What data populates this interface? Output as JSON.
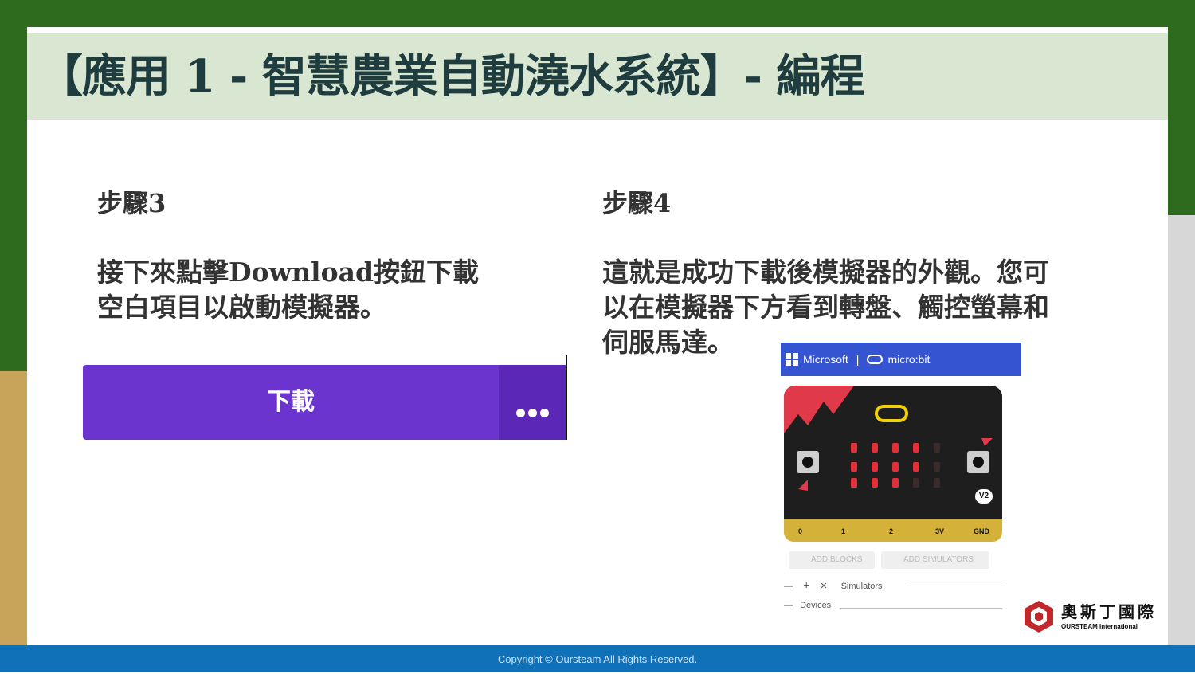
{
  "slide": {
    "title": "【應用 1 - 智慧農業自動澆水系統】- 編程",
    "step3": {
      "label": "步驟3",
      "line1": "接下來點擊Download按鈕下載",
      "line2": "空白項目以啟動模擬器。"
    },
    "step4": {
      "label": "步驟4",
      "line1": "這就是成功下載後模擬器的外觀。您可",
      "line2": "以在模擬器下方看到轉盤、觸控螢幕和",
      "line3": "伺服馬達。"
    }
  },
  "download_button": {
    "label": "下載",
    "more_icon": "ellipsis-icon",
    "color": "#6b34cf"
  },
  "simulator": {
    "brand_microsoft": "Microsoft",
    "separator": "|",
    "brand_microbit": "micro:bit",
    "badge": "V2",
    "pins": [
      "0",
      "1",
      "2",
      "3V",
      "GND"
    ],
    "add_blocks": "ADD BLOCKS",
    "add_simulators": "ADD SIMULATORS",
    "minus": "—",
    "plus": "+",
    "close": "✕",
    "simulators_label": "Simulators",
    "devices_label": "Devices",
    "header_color": "#3454d1"
  },
  "brand": {
    "name_cn": "奧斯丁國際",
    "name_en": "OURSTEAM International"
  },
  "footer": {
    "copyright": "Copyright © Oursteam All Rights Reserved."
  }
}
